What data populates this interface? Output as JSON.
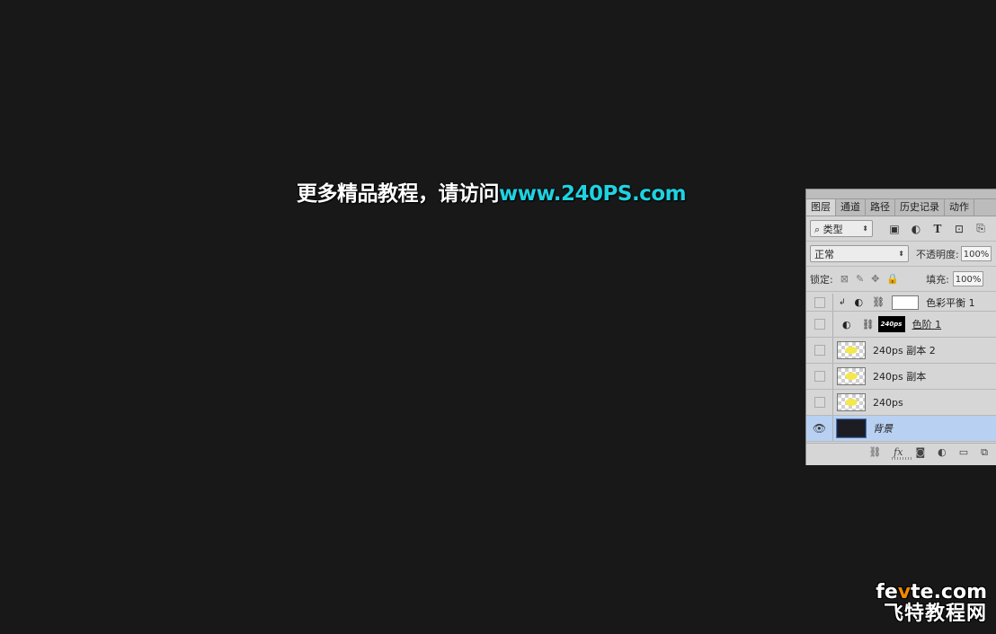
{
  "canvas": {
    "headline_cn": "更多精品教程，请访问",
    "headline_url": "www.240PS.com"
  },
  "panel": {
    "tabs": [
      "图层",
      "通道",
      "路径",
      "历史记录",
      "动作"
    ],
    "filter": {
      "label": "类型"
    },
    "filter_icons": [
      "image-filter-icon",
      "adjustment-filter-icon",
      "text-filter-icon",
      "shape-filter-icon",
      "smart-object-filter-icon"
    ],
    "blend_mode": "正常",
    "opacity_label": "不透明度:",
    "opacity_value": "100%",
    "lock_label": "锁定:",
    "fill_label": "填充:",
    "fill_value": "100%",
    "layers": [
      {
        "name": "色彩平衡 1",
        "visible": false,
        "type": "adjustment",
        "clipped": true
      },
      {
        "name": "色阶 1",
        "visible": false,
        "type": "adjustment-mask",
        "mask_text": "240ps"
      },
      {
        "name": "240ps 副本 2",
        "visible": false,
        "type": "pixel"
      },
      {
        "name": "240ps 副本",
        "visible": false,
        "type": "pixel"
      },
      {
        "name": "240ps",
        "visible": false,
        "type": "pixel"
      },
      {
        "name": "背景",
        "visible": true,
        "type": "background",
        "selected": true
      }
    ],
    "bottom_icons": [
      "link-icon",
      "fx-icon",
      "mask-icon",
      "adjustment-icon",
      "folder-icon",
      "new-layer-icon"
    ],
    "fx_label": "fx"
  },
  "watermark": {
    "url_part1": "fe",
    "url_accent": "v",
    "url_part2": "te.com",
    "site_name": "飞特教程网"
  }
}
